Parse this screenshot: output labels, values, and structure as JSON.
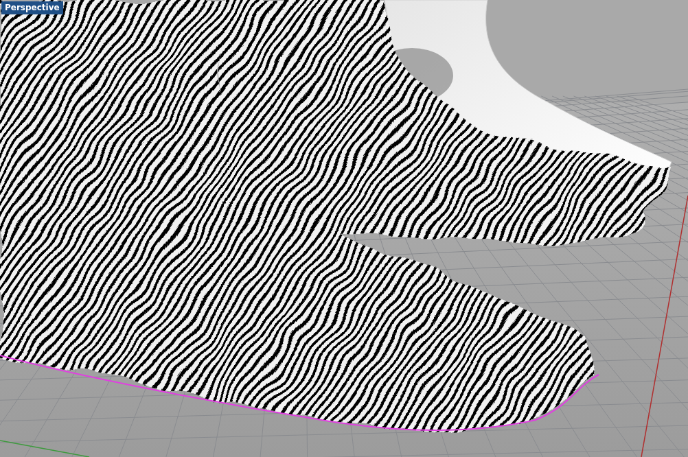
{
  "viewport": {
    "title": "Perspective",
    "active": true
  }
}
